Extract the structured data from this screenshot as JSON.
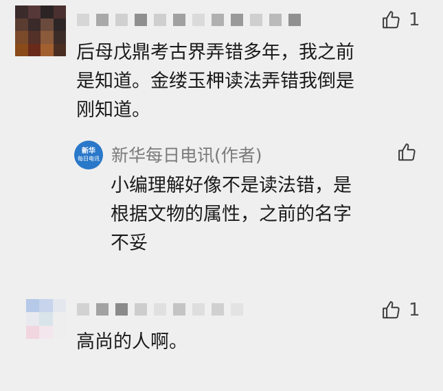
{
  "comments": [
    {
      "likes": "1",
      "text": [
        "后母戊鼎考古界弄错多年，我之前",
        "是知道。金缕玉柙读法弄错我倒是",
        "刚知道。"
      ],
      "reply": {
        "avatar_text_1": "新华",
        "avatar_text_2": "每日电讯",
        "author": "新华每日电讯(作者)",
        "text": [
          "小编理解好像不是读法错，是",
          "根据文物的属性，之前的名字",
          "不妥"
        ]
      }
    },
    {
      "likes": "1",
      "text": [
        "高尚的人啊。"
      ]
    }
  ],
  "colors": {
    "background": "#efefef",
    "text": "#1a1a1a",
    "secondary_text": "#7a7a7a",
    "like_icon": "#3a3a3a",
    "reply_avatar": "#2a78c9"
  },
  "icons": {
    "like": "thumbs-up-icon"
  }
}
